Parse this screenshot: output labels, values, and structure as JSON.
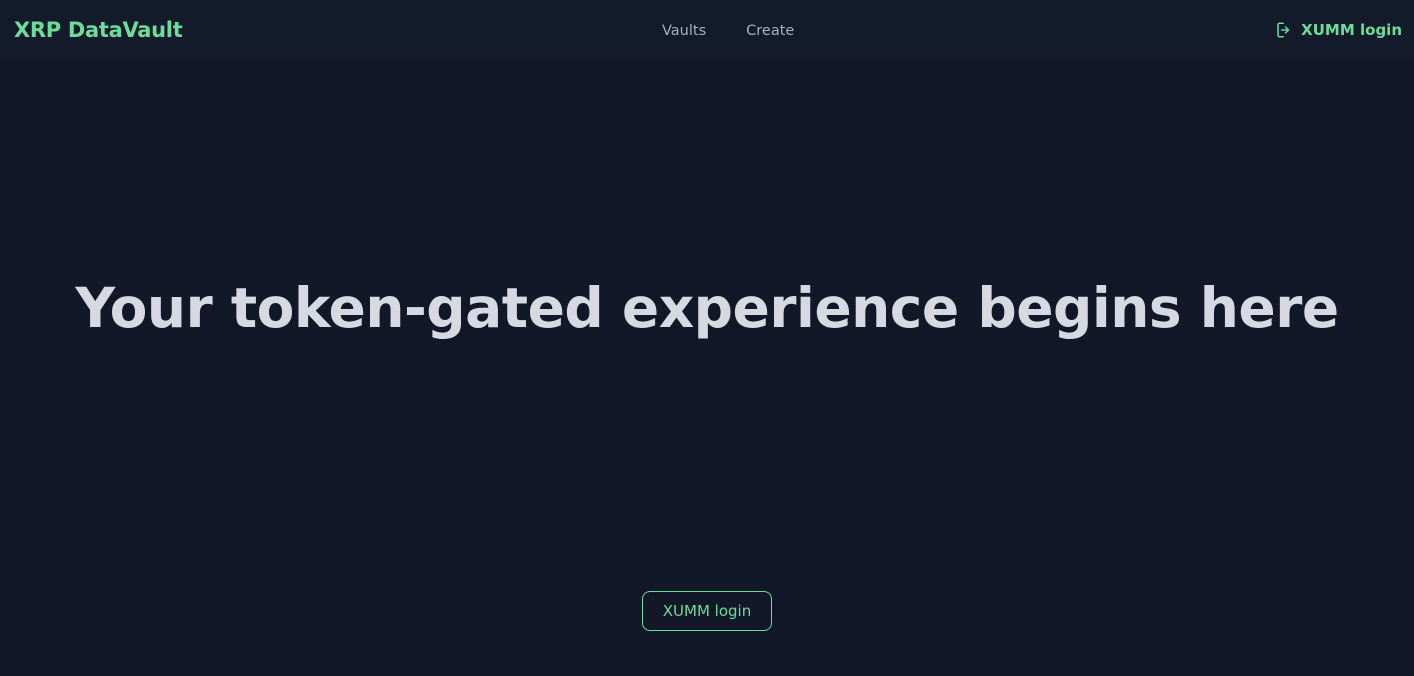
{
  "header": {
    "brand": "XRP DataVault",
    "nav": [
      {
        "label": "Vaults"
      },
      {
        "label": "Create"
      }
    ],
    "login": {
      "label": "XUMM login",
      "icon": "login-icon"
    }
  },
  "hero": {
    "title": "Your token-gated experience begins here",
    "cta_label": "XUMM login"
  },
  "colors": {
    "background": "#121827",
    "accent": "#6ddc9a",
    "heading": "#d6d9e2",
    "nav_text": "#a8b0bf"
  }
}
